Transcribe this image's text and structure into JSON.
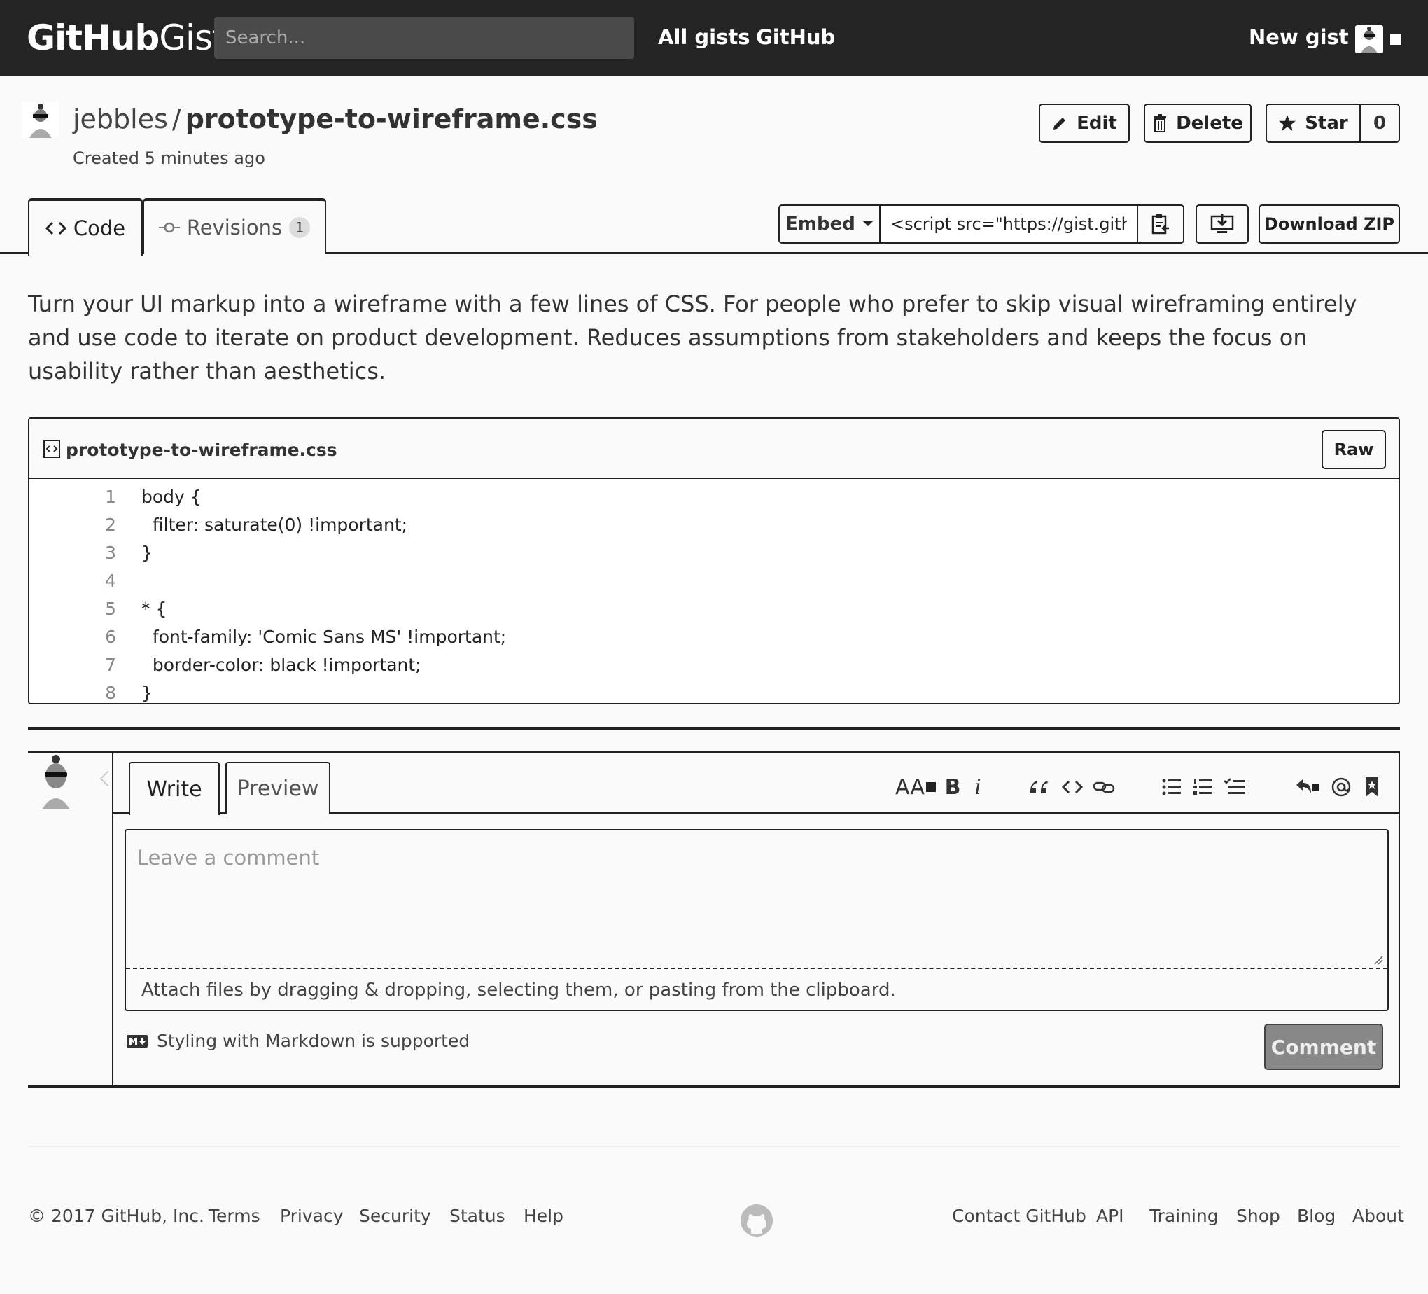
{
  "header": {
    "logo_bold": "GitHub",
    "logo_light": "Gist",
    "search_placeholder": "Search...",
    "nav": [
      "All gists",
      "GitHub"
    ],
    "new_gist": "New gist"
  },
  "gist": {
    "owner": "jebbles",
    "separator": "/",
    "filename": "prototype-to-wireframe.css",
    "created": "Created 5 minutes ago",
    "edit_label": "Edit",
    "delete_label": "Delete",
    "star_label": "Star",
    "star_count": "0"
  },
  "tabs": {
    "code_label": "Code",
    "revisions_label": "Revisions",
    "revisions_count": "1"
  },
  "embed": {
    "label": "Embed",
    "value": "<script src=\"https://gist.githu"
  },
  "download_zip": "Download ZIP",
  "description": "Turn your UI markup into a wireframe with a few lines of CSS. For people who prefer to skip visual wireframing entirely and use code to iterate on product development. Reduces assumptions from stakeholders and keeps the focus on usability rather than aesthetics.",
  "file": {
    "name": "prototype-to-wireframe.css",
    "raw_label": "Raw",
    "lines": [
      {
        "n": "1",
        "code": "body {"
      },
      {
        "n": "2",
        "code": "  filter: saturate(0) !important;"
      },
      {
        "n": "3",
        "code": "}"
      },
      {
        "n": "4",
        "code": ""
      },
      {
        "n": "5",
        "code": "* {"
      },
      {
        "n": "6",
        "code": "  font-family: 'Comic Sans MS' !important;"
      },
      {
        "n": "7",
        "code": "  border-color: black !important;"
      },
      {
        "n": "8",
        "code": "}"
      }
    ]
  },
  "comment": {
    "write_tab": "Write",
    "preview_tab": "Preview",
    "heading_tool": "AA",
    "bold_tool": "B",
    "italic_tool": "i",
    "placeholder": "Leave a comment",
    "attach_text": "Attach files by dragging & dropping, selecting them, or pasting from the clipboard.",
    "markdown_note": "Styling with Markdown is supported",
    "submit_label": "Comment"
  },
  "footer": {
    "copyright": "© 2017 GitHub, Inc.",
    "left_links": [
      "Terms",
      "Privacy",
      "Security",
      "Status",
      "Help"
    ],
    "right_links": [
      "Contact GitHub",
      "API",
      "Training",
      "Shop",
      "Blog",
      "About"
    ]
  }
}
